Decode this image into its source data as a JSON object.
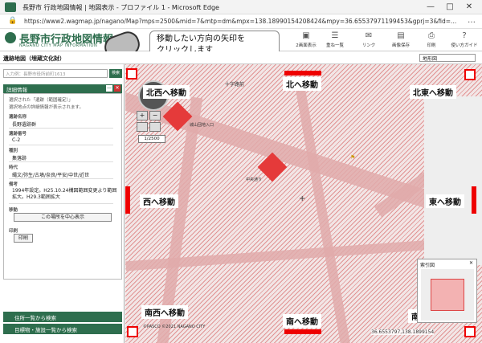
{
  "window": {
    "title": "長野市 行政地図情報 | 地図表示 - プロファイル 1 - Microsoft Edge",
    "url": "https://www2.wagmap.jp/nagano/Map?mps=2500&mid=7&mtp=dm&mpx=138.18990154208424&mpy=36.65537971199453&gprj=3&fid=..."
  },
  "site": {
    "logo_main": "長野市行政地図情報",
    "logo_sub": "NAGANO CITY MAP INFORMATION",
    "toolbar": [
      {
        "label": "2画面表示",
        "icon": "split-icon"
      },
      {
        "label": "重ね一覧",
        "icon": "layers-icon"
      },
      {
        "label": "リンク",
        "icon": "link-icon"
      },
      {
        "label": "画像保存",
        "icon": "save-icon"
      },
      {
        "label": "印刷",
        "icon": "print-icon"
      },
      {
        "label": "使い方ガイド",
        "icon": "guide-icon"
      }
    ]
  },
  "subbar": {
    "map_name": "遺跡地図（埋蔵文化財）",
    "search_placeholder": "入力例：長野市役所前町1613",
    "search_button": "検索",
    "layer_select": "地形図"
  },
  "panel": {
    "title": "詳細情報",
    "desc1": "選択された「遺跡（範囲確定）」",
    "desc2": "選択地点の詳細情報が表示されます。",
    "fields": [
      {
        "label": "遺跡名称",
        "value": "長野遺跡群"
      },
      {
        "label": "遺跡番号",
        "value": "C-2"
      },
      {
        "label": "種別",
        "value": "集落跡"
      },
      {
        "label": "時代",
        "value": "縄文/弥生/古墳/奈良/平安/中世/近世"
      },
      {
        "label": "備考",
        "value": "1994年設定。H25.10.24構図範囲変更より範囲拡大。H29.3範囲拡大"
      }
    ],
    "move_label": "移動",
    "center_button": "この場所を中心表示",
    "print_label": "印刷",
    "print_button": "印刷",
    "bottom1": "住所一覧から検索",
    "bottom2": "目標物・施設一覧から検索"
  },
  "map": {
    "callout": "移動したい方向の矢印を\nクリックします",
    "scale": "1/2500",
    "directions": {
      "n": "北へ移動",
      "ne": "北東へ移動",
      "e": "東へ移動",
      "se": "南東へ移動",
      "s": "南へ移動",
      "sw": "南西へ移動",
      "w": "西へ移動",
      "nw": "北西へ移動"
    },
    "map_labels": [
      "十字路前",
      "城山団地入口",
      "中央通り"
    ],
    "minimap_title": "索引図",
    "coords": "36.6553797,138.1899154",
    "copyright": "©PASCO ©2021 NAGANO CITY"
  }
}
